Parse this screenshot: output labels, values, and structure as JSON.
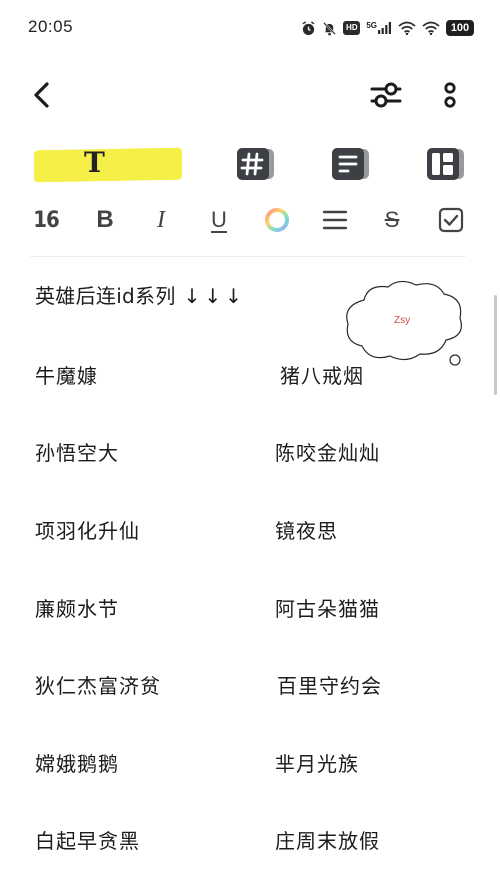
{
  "status_bar": {
    "time": "20:05",
    "hd_label": "HD",
    "network_label": "5G",
    "battery_level": "100"
  },
  "toolbar": {
    "text_style_glyph": "T"
  },
  "format_bar": {
    "font_size": "16",
    "bold": "B",
    "italic": "I",
    "underline": "U",
    "strikethrough": "S"
  },
  "note": {
    "heading": "英雄后连id系列",
    "heading_arrows": "↓↓↓",
    "sticker_text": "Zsy",
    "rows": [
      {
        "left": "牛魔嫝",
        "right": "猪八戒烟"
      },
      {
        "left": "孙悟空大",
        "right": "陈咬金灿灿"
      },
      {
        "left": "项羽化升仙",
        "right": "镜夜思"
      },
      {
        "left": "廉颇水节",
        "right": "阿古朵猫猫"
      },
      {
        "left": "狄仁杰富济贫",
        "right": "百里守约会"
      },
      {
        "left": "嫦娥鹅鹅",
        "right": "芈月光族"
      },
      {
        "left": "白起早贪黑",
        "right": "庄周末放假"
      }
    ]
  }
}
